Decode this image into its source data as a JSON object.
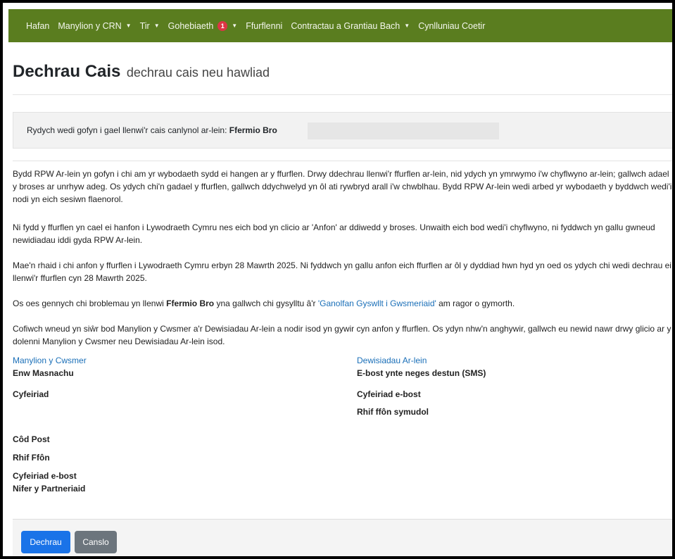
{
  "nav": {
    "items": [
      {
        "label": "Hafan"
      },
      {
        "label": "Manylion y CRN",
        "dropdown": true
      },
      {
        "label": "Tir",
        "dropdown": true
      },
      {
        "label": "Gohebiaeth",
        "badge": "1",
        "dropdown": true
      },
      {
        "label": "Ffurflenni"
      },
      {
        "label": "Contractau a Grantiau Bach",
        "dropdown": true
      },
      {
        "label": "Cynlluniau Coetir"
      }
    ],
    "bg_color": "#5a7d1f"
  },
  "page": {
    "title": "Dechrau Cais",
    "subtitle": "dechrau cais neu hawliad"
  },
  "alert": {
    "text": "Rydych wedi gofyn i gael llenwi'r cais canlynol ar-lein: ",
    "form_name": "Ffermio Bro"
  },
  "paragraphs": {
    "p1": "Bydd RPW Ar-lein yn gofyn i chi am yr wybodaeth sydd ei hangen ar y ffurflen. Drwy ddechrau llenwi'r ffurflen ar-lein, nid ydych yn ymrwymo i'w chyflwyno ar-lein; gallwch adael y broses ar unrhyw adeg. Os ydych chi'n gadael y ffurflen, gallwch ddychwelyd yn ôl ati rywbryd arall i'w chwblhau. Bydd RPW Ar-lein wedi arbed yr wybodaeth y byddwch wedi'i nodi yn eich sesiwn flaenorol.",
    "p2": "Ni fydd y ffurflen yn cael ei hanfon i Lywodraeth Cymru nes eich bod yn clicio ar 'Anfon' ar ddiwedd y broses. Unwaith eich bod wedi'i chyflwyno, ni fyddwch yn gallu gwneud newidiadau iddi gyda RPW Ar-lein.",
    "p3": "Mae'n rhaid i chi anfon y ffurflen i Lywodraeth Cymru erbyn 28 Mawrth 2025. Ni fyddwch yn gallu anfon eich ffurflen ar ôl y dyddiad hwn hyd yn oed os ydych chi wedi dechrau ei llenwi'r ffurflen cyn 28 Mawrth 2025.",
    "p4_pre": "Os oes gennych chi broblemau yn llenwi ",
    "p4_bold": "Ffermio Bro",
    "p4_mid": " yna gallwch chi gysylltu â'r ",
    "p4_link": "'Ganolfan Gyswllt i Gwsmeriaid'",
    "p4_post": " am ragor o gymorth.",
    "p5": "Cofiwch wneud yn siŵr bod Manylion y Cwsmer a'r Dewisiadau Ar-lein a nodir isod yn gywir cyn anfon y ffurflen. Os ydyn nhw'n anghywir, gallwch eu newid nawr drwy glicio ar y dolenni Manylion y Cwsmer neu Dewisiadau Ar-lein isod."
  },
  "customer": {
    "link": "Manylion y Cwsmer",
    "trading_name": "Enw Masnachu",
    "address": "Cyfeiriad",
    "postcode": "Côd Post",
    "phone": "Rhif Ffôn",
    "email": "Cyfeiriad e-bost",
    "partners": "Nifer y Partneriaid"
  },
  "online": {
    "link": "Dewisiadau Ar-lein",
    "sms": "E-bost ynte neges destun (SMS)",
    "email": "Cyfeiriad e-bost",
    "mobile": "Rhif ffôn symudol"
  },
  "buttons": {
    "start": "Dechrau",
    "cancel": "Canslo"
  }
}
